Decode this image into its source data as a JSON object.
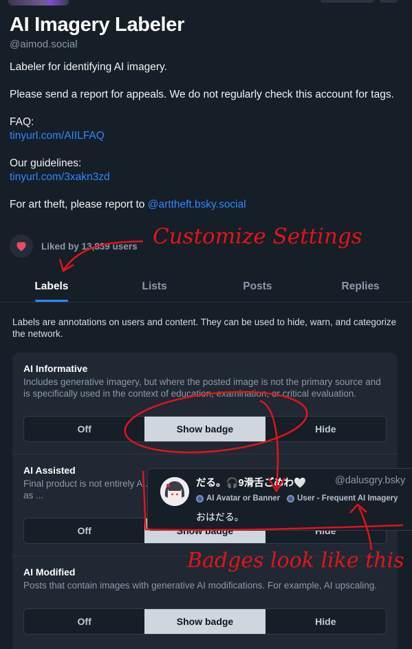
{
  "profile": {
    "title": "AI Imagery Labeler",
    "handle": "@aimod.social",
    "bio_line1": "Labeler for identifying AI imagery.",
    "bio_line2": "Please send a report for appeals. We do not regularly check this account for tags.",
    "faq_label": "FAQ:",
    "faq_link": "tinyurl.com/AIILFAQ",
    "guidelines_label": "Our guidelines:",
    "guidelines_link": "tinyurl.com/3xakn3zd",
    "art_theft_text": "For art theft, please report to ",
    "art_theft_link": "@arttheft.bsky.social",
    "liked_by": "Liked by 13,839 users"
  },
  "tabs": [
    "Labels",
    "Lists",
    "Posts",
    "Replies"
  ],
  "active_tab": "Labels",
  "labels_intro": "Labels are annotations on users and content. They can be used to hide, warn, and categorize the network.",
  "segment_options": {
    "off": "Off",
    "show": "Show badge",
    "hide": "Hide"
  },
  "labels": [
    {
      "title": "AI Informative",
      "description": "Includes generative imagery, but where the posted image is not the primary source and is specifically used in the context of education, examination, or critical evaluation.",
      "selected": "Show badge"
    },
    {
      "title": "AI Assisted",
      "description": "Final product is not entirely A... composition of the work. Mus... this label to a user, such as ...",
      "selected": "Show badge"
    },
    {
      "title": "AI Modified",
      "description": "Posts that contain images with generative AI modifications. For example, AI upscaling.",
      "selected": "Show badge"
    }
  ],
  "popup": {
    "display_name": "だる。🎧9滑舌ごめわ🤍",
    "handle": "@dalusgry.bsky",
    "badges": [
      "AI Avatar or Banner",
      "User - Frequent AI Imagery"
    ],
    "post_text": "おはだる。"
  },
  "annotations": {
    "customize": "Customize Settings",
    "badges": "Badges look like this"
  },
  "colors": {
    "background": "#161e27",
    "card": "#1f2833",
    "accent": "#2f88ff",
    "like": "#ec4868",
    "annotation": "#e3141a"
  }
}
